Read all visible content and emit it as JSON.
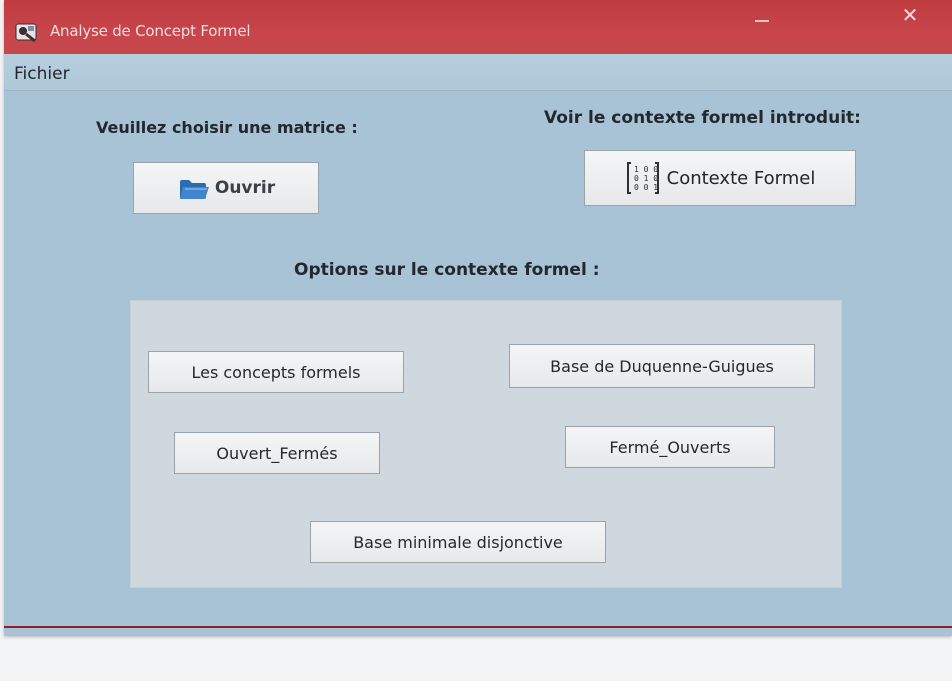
{
  "window": {
    "title": "Analyse de Concept Formel",
    "close_glyph": "✕"
  },
  "menu": {
    "items": [
      {
        "label": "Fichier"
      }
    ]
  },
  "labels": {
    "choose_matrix": "Veuillez choisir une matrice :",
    "view_context": "Voir le contexte formel introduit:",
    "options": "Options sur le contexte formel :"
  },
  "buttons": {
    "ouvrir": "Ouvrir",
    "contexte_formel": "Contexte Formel",
    "concepts_formels": "Les concepts formels",
    "base_duquenne_guigues": "Base de Duquenne-Guigues",
    "ouvert_fermes": "Ouvert_Fermés",
    "ferme_ouverts": "Fermé_Ouverts",
    "base_minimale_disjonctive": "Base minimale disjonctive"
  },
  "icons": {
    "app": "app-icon",
    "folder": "folder-icon",
    "matrix": "matrix-icon"
  },
  "colors": {
    "titlebar": "#c4484c",
    "window_background": "#a9c3d6",
    "panel_background": "#cfd8de"
  }
}
